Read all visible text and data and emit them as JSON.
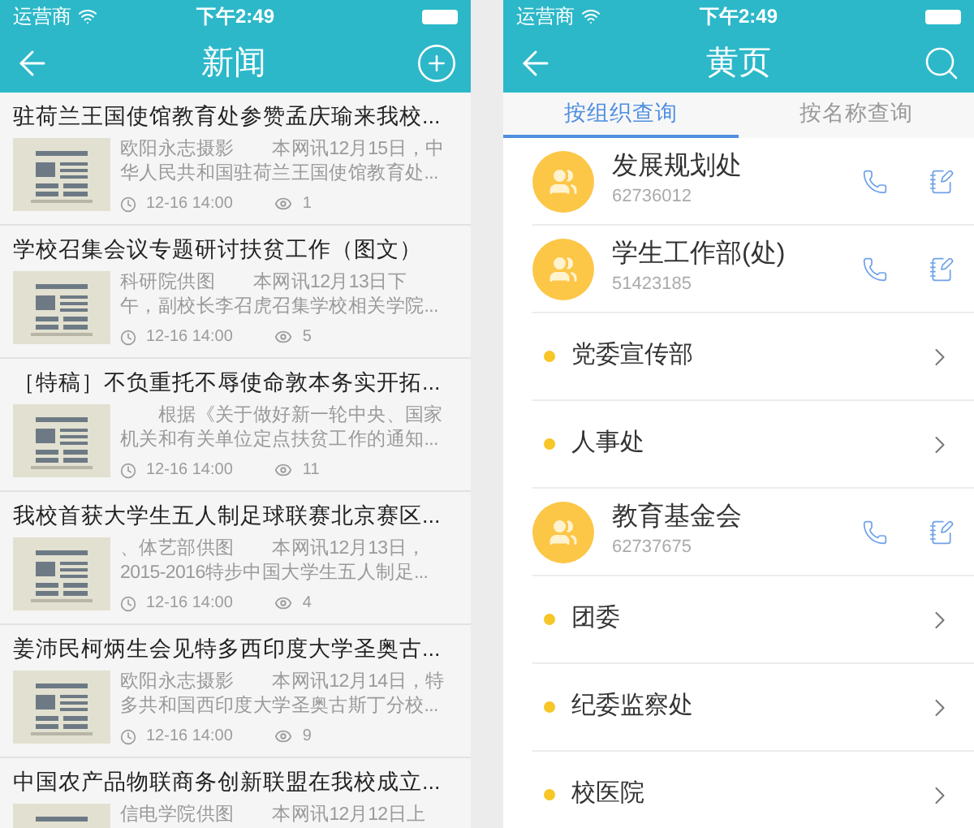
{
  "news_screen": {
    "status_bar": {
      "carrier": "运营商",
      "time": "下午2:49"
    },
    "title": "新闻",
    "items": [
      {
        "title": "驻荷兰王国使馆教育处参赞孟庆瑜来我校...",
        "summary_lines": [
          "欧阳永志摄影　　本网讯12月15日，中",
          "华人民共和国驻荷兰王国使馆教育处..."
        ],
        "date": "12-16 14:00",
        "views": "1"
      },
      {
        "title": "学校召集会议专题研讨扶贫工作（图文）",
        "summary_lines": [
          "科研院供图　　本网讯12月13日下",
          "午，副校长李召虎召集学校相关学院..."
        ],
        "date": "12-16 14:00",
        "views": "5"
      },
      {
        "title": "［特稿］不负重托不辱使命敦本务实开拓...",
        "summary_lines": [
          "　　根据《关于做好新一轮中央、国家",
          "机关和有关单位定点扶贫工作的通知..."
        ],
        "date": "12-16 14:00",
        "views": "11"
      },
      {
        "title": "我校首获大学生五人制足球联赛北京赛区...",
        "summary_lines": [
          "、体艺部供图　　本网讯12月13日，",
          "2015-2016特步中国大学生五人制足..."
        ],
        "date": "12-16 14:00",
        "views": "4"
      },
      {
        "title": "姜沛民柯炳生会见特多西印度大学圣奥古...",
        "summary_lines": [
          "欧阳永志摄影　　本网讯12月14日，特",
          "多共和国西印度大学圣奥古斯丁分校..."
        ],
        "date": "12-16 14:00",
        "views": "9"
      },
      {
        "title": "中国农产品物联商务创新联盟在我校成立...",
        "summary_lines": [
          "信电学院供图　　本网讯12月12日上"
        ]
      }
    ]
  },
  "directory_screen": {
    "status_bar": {
      "carrier": "运营商",
      "time": "下午2:49"
    },
    "title": "黄页",
    "tabs": [
      {
        "label": "按组织查询",
        "selected": true
      },
      {
        "label": "按名称查询",
        "selected": false
      }
    ],
    "entries": [
      {
        "kind": "contact",
        "name": "发展规划处",
        "phone": "62736012"
      },
      {
        "kind": "contact",
        "name": "学生工作部(处)",
        "phone": "51423185"
      },
      {
        "kind": "unit",
        "name": "党委宣传部"
      },
      {
        "kind": "unit",
        "name": "人事处"
      },
      {
        "kind": "contact",
        "name": "教育基金会",
        "phone": "62737675"
      },
      {
        "kind": "unit",
        "name": "团委"
      },
      {
        "kind": "unit",
        "name": "纪委监察处"
      },
      {
        "kind": "unit",
        "name": "校医院"
      }
    ]
  }
}
